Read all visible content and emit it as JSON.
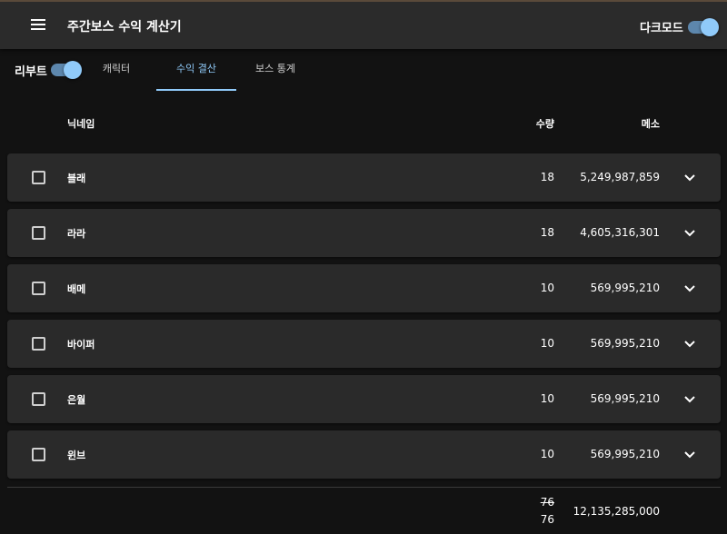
{
  "header": {
    "title": "주간보스 수익 계산기",
    "dark_mode_label": "다크모드",
    "dark_mode_on": true
  },
  "reboot": {
    "label": "리부트",
    "on": true
  },
  "tabs": [
    {
      "label": "캐릭터",
      "active": false
    },
    {
      "label": "수익 결산",
      "active": true
    },
    {
      "label": "보스 통계",
      "active": false
    }
  ],
  "table": {
    "headers": {
      "nickname": "닉네임",
      "quantity": "수량",
      "meso": "메소"
    },
    "rows": [
      {
        "nickname": "블래",
        "quantity": "18",
        "meso": "5,249,987,859",
        "checked": false
      },
      {
        "nickname": "라라",
        "quantity": "18",
        "meso": "4,605,316,301",
        "checked": false
      },
      {
        "nickname": "배메",
        "quantity": "10",
        "meso": "569,995,210",
        "checked": false
      },
      {
        "nickname": "바이퍼",
        "quantity": "10",
        "meso": "569,995,210",
        "checked": false
      },
      {
        "nickname": "은월",
        "quantity": "10",
        "meso": "569,995,210",
        "checked": false
      },
      {
        "nickname": "윈브",
        "quantity": "10",
        "meso": "569,995,210",
        "checked": false
      }
    ],
    "totals": {
      "quantity_struck": "76",
      "quantity": "76",
      "meso": "12,135,285,000"
    }
  },
  "colors": {
    "accent": "#90caf9",
    "background": "#121212",
    "surface": "#2a2a2a",
    "appbar": "#2b2b2b"
  },
  "icons": {
    "menu": "menu-icon",
    "row_expand": "chevron-down-icon"
  }
}
